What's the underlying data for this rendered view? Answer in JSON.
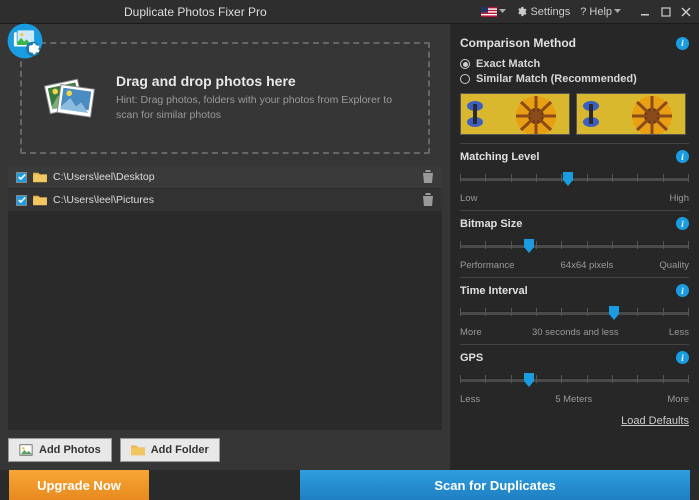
{
  "title": "Duplicate Photos Fixer Pro",
  "titlebar": {
    "settings": "Settings",
    "help": "? Help",
    "lang": "US"
  },
  "drop": {
    "heading": "Drag and drop photos here",
    "hint": "Hint: Drag photos, folders with your photos from Explorer to scan for similar photos"
  },
  "files": [
    {
      "path": "C:\\Users\\leel\\Desktop"
    },
    {
      "path": "C:\\Users\\leel\\Pictures"
    }
  ],
  "buttons": {
    "addPhotos": "Add Photos",
    "addFolder": "Add Folder"
  },
  "footer": {
    "upgrade": "Upgrade Now",
    "scan": "Scan for Duplicates"
  },
  "comparison": {
    "heading": "Comparison Method",
    "exact": "Exact Match",
    "similar": "Similar Match",
    "recommended": "(Recommended)"
  },
  "sliders": {
    "matching": {
      "label": "Matching Level",
      "low": "Low",
      "high": "High",
      "pos": 45
    },
    "bitmap": {
      "label": "Bitmap Size",
      "low": "Performance",
      "high": "Quality",
      "center": "64x64 pixels",
      "pos": 28
    },
    "time": {
      "label": "Time Interval",
      "low": "More",
      "high": "Less",
      "center": "30 seconds and less",
      "pos": 65
    },
    "gps": {
      "label": "GPS",
      "low": "Less",
      "high": "More",
      "center": "5 Meters",
      "pos": 28
    }
  },
  "loadDefaults": "Load Defaults"
}
